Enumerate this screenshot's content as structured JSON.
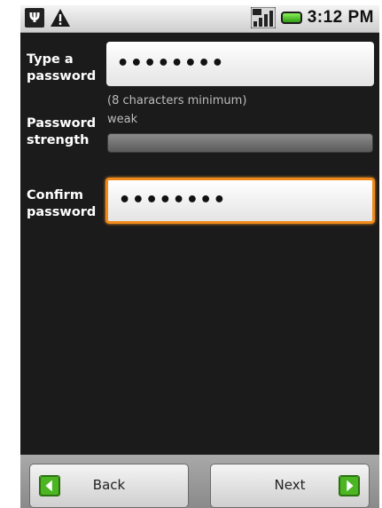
{
  "status_bar": {
    "time": "3:12 PM",
    "icons": [
      "usb-icon",
      "warning-icon",
      "signal-icon",
      "battery-icon"
    ],
    "battery_color": "#3cc41e"
  },
  "form": {
    "password_label_line1": "Type a",
    "password_label_line2": "password",
    "password_value": "••••••••",
    "password_hint": "(8 characters minimum)",
    "strength_label_line1": "Password",
    "strength_label_line2": "strength",
    "strength_value": "weak",
    "strength_level": 0,
    "confirm_label_line1": "Confirm",
    "confirm_label_line2": "password",
    "confirm_value": "••••••••",
    "focus_color": "#f08a1a"
  },
  "buttons": {
    "back_label": "Back",
    "next_label": "Next",
    "accent": "#3fa81f"
  }
}
